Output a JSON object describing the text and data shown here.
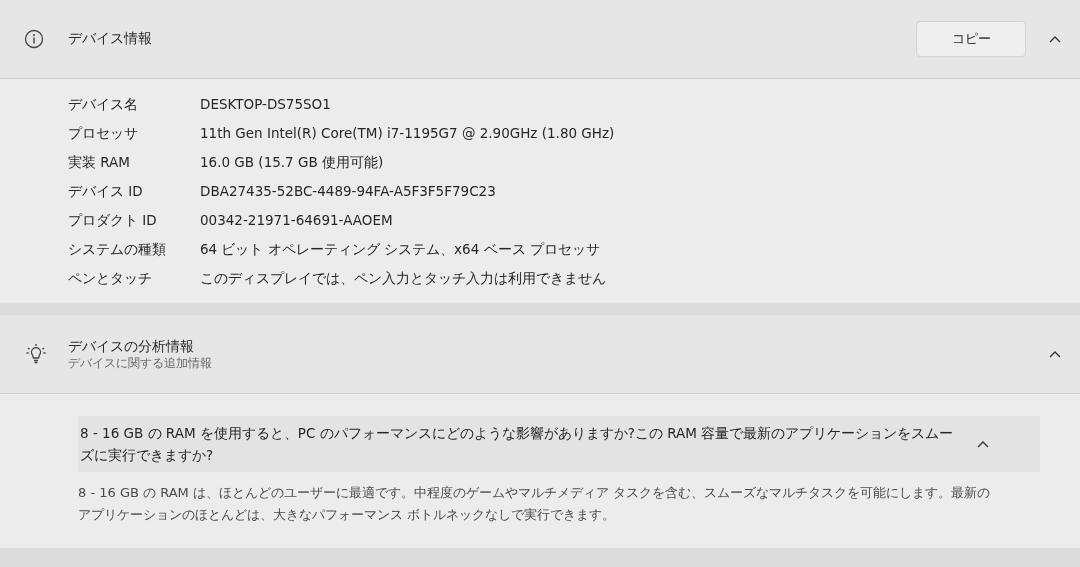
{
  "device_info": {
    "title": "デバイス情報",
    "copy_button": "コピー",
    "expanded": true,
    "specs": [
      {
        "label": "デバイス名",
        "value": "DESKTOP-DS75SO1"
      },
      {
        "label": "プロセッサ",
        "value": "11th Gen Intel(R) Core(TM) i7-1195G7 @ 2.90GHz (1.80 GHz)"
      },
      {
        "label": "実装 RAM",
        "value": "16.0 GB (15.7 GB 使用可能)"
      },
      {
        "label": "デバイス ID",
        "value": "DBA27435-52BC-4489-94FA-A5F3F5F79C23"
      },
      {
        "label": "プロダクト ID",
        "value": "00342-21971-64691-AAOEM"
      },
      {
        "label": "システムの種類",
        "value": "64 ビット オペレーティング システム、x64 ベース プロセッサ"
      },
      {
        "label": "ペンとタッチ",
        "value": "このディスプレイでは、ペン入力とタッチ入力は利用できません"
      }
    ]
  },
  "device_insights": {
    "title": "デバイスの分析情報",
    "subtitle": "デバイスに関する追加情報",
    "expanded": true,
    "faq": [
      {
        "question": "8 - 16 GB の RAM を使用すると、PC のパフォーマンスにどのような影響がありますか?この RAM 容量で最新のアプリケーションをスムーズに実行できますか?",
        "expanded": true,
        "answer": "8 - 16 GB の RAM は、ほとんどのユーザーに最適です。中程度のゲームやマルチメディア タスクを含む、スムーズなマルチタスクを可能にします。最新のアプリケーションのほとんどは、大きなパフォーマンス ボトルネックなしで実行できます。"
      }
    ]
  }
}
